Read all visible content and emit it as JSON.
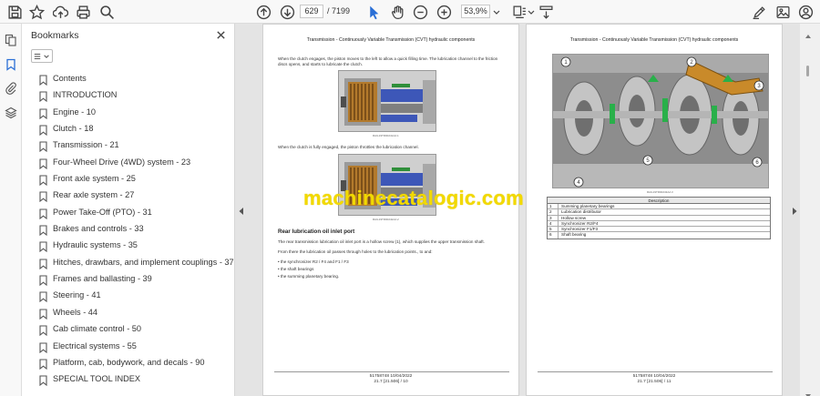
{
  "toolbar": {
    "page_current": "629",
    "page_total": "/ 7199",
    "zoom": "53,9%"
  },
  "panel": {
    "title": "Bookmarks",
    "items": [
      {
        "label": "Contents"
      },
      {
        "label": "INTRODUCTION"
      },
      {
        "label": "Engine - 10"
      },
      {
        "label": "Clutch - 18"
      },
      {
        "label": "Transmission - 21"
      },
      {
        "label": "Four-Wheel Drive (4WD) system - 23"
      },
      {
        "label": "Front axle system - 25"
      },
      {
        "label": "Rear axle system - 27"
      },
      {
        "label": "Power Take-Off (PTO) - 31"
      },
      {
        "label": "Brakes and controls - 33"
      },
      {
        "label": "Hydraulic systems - 35"
      },
      {
        "label": "Hitches, drawbars, and implement couplings - 37"
      },
      {
        "label": "Frames and ballasting - 39"
      },
      {
        "label": "Steering - 41"
      },
      {
        "label": "Wheels - 44"
      },
      {
        "label": "Cab climate control - 50"
      },
      {
        "label": "Electrical systems - 55"
      },
      {
        "label": "Platform, cab, bodywork, and decals - 90"
      },
      {
        "label": "SPECIAL TOOL INDEX"
      }
    ]
  },
  "left_page": {
    "header": "Transmission - Continuously Variable Transmission (CVT) hydraulic components",
    "para1": "When the clutch engages, the piston moves to the left to allow a quick filling time. The lubrication channel to the friction discs opens, and starts to lubricate the clutch.",
    "para2": "When the clutch is fully engaged, the piston throttles the lubrication channel.",
    "heading": "Rear lubrication oil inlet port",
    "para3": "The rear transmission lubrication oil inlet port is a hollow screw (1), which supplies the upper transmission shaft.",
    "para4": "From there the lubrication oil passes through holes to the lubrication points., to and:",
    "bullets": [
      "the synchronizer R2 / F4 and F1 / F3",
      "the shaft bearings",
      "the summing planetary bearing."
    ],
    "footer_code": "51758748 10/04/2022",
    "footer_page": "21.7 [21.506] / 10"
  },
  "right_page": {
    "header": "Transmission - Continuously Variable Transmission (CVT) hydraulic components",
    "legend_title": "Description",
    "legend": [
      {
        "num": "1",
        "desc": "Summing planetary bearings"
      },
      {
        "num": "2",
        "desc": "Lubrication distributor"
      },
      {
        "num": "3",
        "desc": "Hollow screw"
      },
      {
        "num": "4",
        "desc": "Synchronizer R2/F4"
      },
      {
        "num": "5",
        "desc": "Synchronizer F1/F3"
      },
      {
        "num": "6",
        "desc": "Shaft bearing"
      }
    ],
    "footer_code": "51758748 10/04/2022",
    "footer_page": "21.7 [21.506] / 11"
  },
  "watermark": "machinecatalogic.com",
  "colors": {
    "accent": "#2a6fd6",
    "watermark": "#f2d900"
  }
}
